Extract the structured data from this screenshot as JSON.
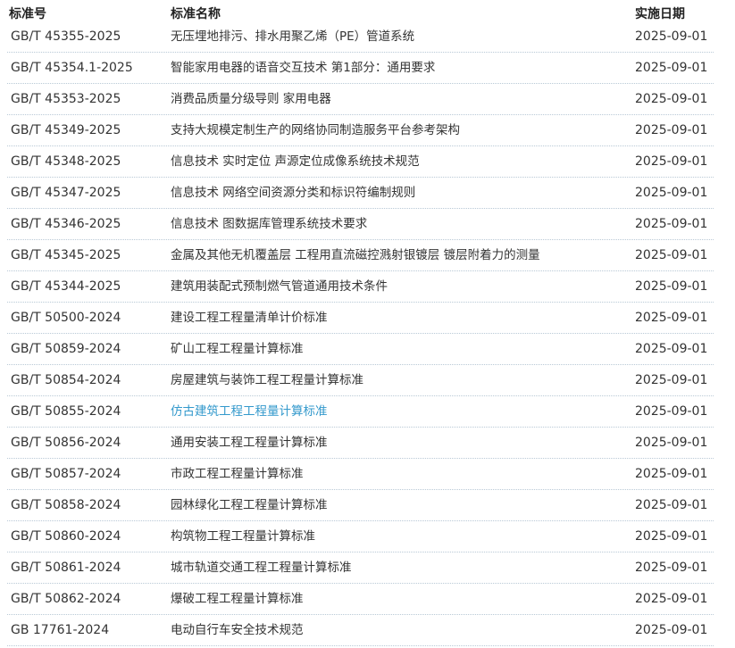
{
  "table": {
    "headers": {
      "number": "标准号",
      "name": "标准名称",
      "date": "实施日期"
    },
    "rows": [
      {
        "number": "GB/T 45355-2025",
        "name": "无压埋地排污、排水用聚乙烯（PE）管道系统",
        "date": "2025-09-01"
      },
      {
        "number": "GB/T 45354.1-2025",
        "name": "智能家用电器的语音交互技术 第1部分：通用要求",
        "date": "2025-09-01"
      },
      {
        "number": "GB/T 45353-2025",
        "name": "消费品质量分级导则 家用电器",
        "date": "2025-09-01"
      },
      {
        "number": "GB/T 45349-2025",
        "name": "支持大规模定制生产的网络协同制造服务平台参考架构",
        "date": "2025-09-01"
      },
      {
        "number": "GB/T 45348-2025",
        "name": "信息技术 实时定位 声源定位成像系统技术规范",
        "date": "2025-09-01"
      },
      {
        "number": "GB/T 45347-2025",
        "name": "信息技术 网络空间资源分类和标识符编制规则",
        "date": "2025-09-01"
      },
      {
        "number": "GB/T 45346-2025",
        "name": "信息技术 图数据库管理系统技术要求",
        "date": "2025-09-01"
      },
      {
        "number": "GB/T 45345-2025",
        "name": "金属及其他无机覆盖层 工程用直流磁控溅射银镀层 镀层附着力的测量",
        "date": "2025-09-01"
      },
      {
        "number": "GB/T 45344-2025",
        "name": "建筑用装配式预制燃气管道通用技术条件",
        "date": "2025-09-01"
      },
      {
        "number": "GB/T 50500-2024",
        "name": "建设工程工程量清单计价标准",
        "date": "2025-09-01"
      },
      {
        "number": "GB/T 50859-2024",
        "name": "矿山工程工程量计算标准",
        "date": "2025-09-01"
      },
      {
        "number": "GB/T 50854-2024",
        "name": "房屋建筑与装饰工程工程量计算标准",
        "date": "2025-09-01"
      },
      {
        "number": "GB/T 50855-2024",
        "name": "仿古建筑工程工程量计算标准",
        "date": "2025-09-01",
        "highlight": true
      },
      {
        "number": "GB/T 50856-2024",
        "name": "通用安装工程工程量计算标准",
        "date": "2025-09-01"
      },
      {
        "number": "GB/T 50857-2024",
        "name": "市政工程工程量计算标准",
        "date": "2025-09-01"
      },
      {
        "number": "GB/T 50858-2024",
        "name": "园林绿化工程工程量计算标准",
        "date": "2025-09-01"
      },
      {
        "number": "GB/T 50860-2024",
        "name": "构筑物工程工程量计算标准",
        "date": "2025-09-01"
      },
      {
        "number": "GB/T 50861-2024",
        "name": "城市轨道交通工程工程量计算标准",
        "date": "2025-09-01"
      },
      {
        "number": "GB/T 50862-2024",
        "name": "爆破工程工程量计算标准",
        "date": "2025-09-01"
      },
      {
        "number": "GB 17761-2024",
        "name": "电动自行车安全技术规范",
        "date": "2025-09-01"
      }
    ]
  },
  "colors": {
    "link": "#3399cc",
    "text": "#333333",
    "divider": "#b9c9d6"
  }
}
